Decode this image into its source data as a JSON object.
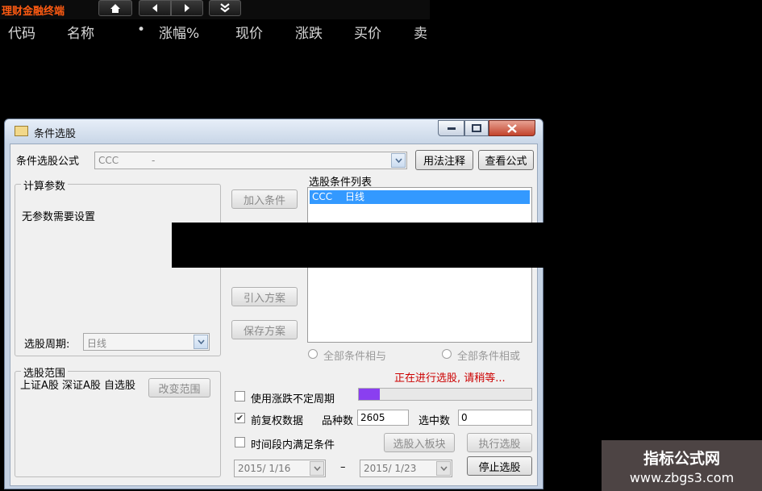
{
  "app": {
    "title": "理财金融终端",
    "nav": [
      "home-icon",
      "arrow-left-icon",
      "arrow-right-icon",
      "double-chevron-down-icon"
    ]
  },
  "columns": [
    "代码",
    "名称",
    "•",
    "涨幅%",
    "现价",
    "涨跌",
    "买价",
    "卖"
  ],
  "dialog": {
    "title": "条件选股",
    "formula_label": "条件选股公式",
    "formula_value": "CCC",
    "formula_dash": "-",
    "usage_button": "用法注释",
    "view_formula_button": "查看公式",
    "params_group": "计算参数",
    "params_text": "无参数需要设置",
    "period_label": "选股周期:",
    "period_value": "日线",
    "scope_group": "选股范围",
    "scope_text": "上证A股 深证A股 自选股",
    "change_scope_button": "改变范围",
    "add_condition_button": "加入条件",
    "import_plan_button": "引入方案",
    "save_plan_button": "保存方案",
    "list_label": "选股条件列表",
    "conditions": [
      {
        "name": "CCC",
        "period": "日线"
      }
    ],
    "radio_and": "全部条件相与",
    "radio_or": "全部条件相或",
    "status": "正在进行选股, 请稍等...",
    "status_color": "#cc0000",
    "progress_color": "#8a3ff0",
    "progress_fraction": 0.12,
    "use_uncertain_period": "使用涨跌不定周期",
    "adjusted_data": "前复权数据",
    "variety_count_label": "品种数",
    "variety_count": "2605",
    "selected_count_label": "选中数",
    "selected_count": "0",
    "time_condition": "时间段内满足条件",
    "to_block_button": "选股入板块",
    "execute_button": "执行选股",
    "stop_button": "停止选股",
    "start_date": "2015/ 1/16",
    "range_dash": "–",
    "end_date": "2015/ 1/23"
  },
  "watermark": {
    "title": "指标公式网",
    "url": "www.zbgs3.com"
  }
}
